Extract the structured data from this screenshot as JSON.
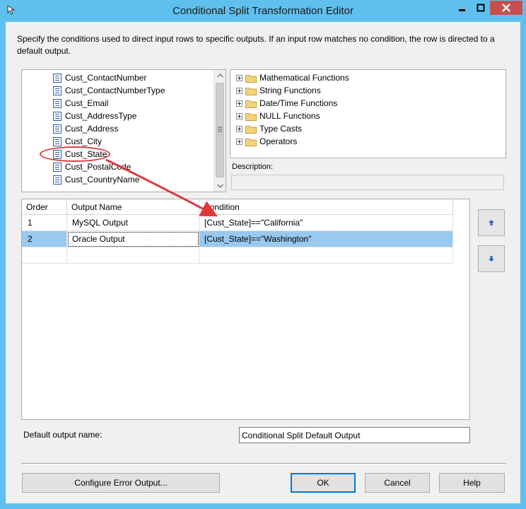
{
  "window": {
    "title": "Conditional Split Transformation Editor"
  },
  "instructions": "Specify the conditions used to direct input rows to specific outputs. If an input row matches no condition, the row is directed to a default output.",
  "columns": [
    "Cust_ContactNumber",
    "Cust_ContactNumberType",
    "Cust_Email",
    "Cust_AddressType",
    "Cust_Address",
    "Cust_City",
    "Cust_State",
    "Cust_PostalCode",
    "Cust_CountryName"
  ],
  "functions": [
    "Mathematical Functions",
    "String Functions",
    "Date/Time Functions",
    "NULL Functions",
    "Type Casts",
    "Operators"
  ],
  "description": {
    "label": "Description:",
    "value": ""
  },
  "grid": {
    "headers": [
      "Order",
      "Output Name",
      "Condition"
    ],
    "rows": [
      {
        "order": "1",
        "name": "MySQL Output",
        "condition": "[Cust_State]==\"California\""
      },
      {
        "order": "2",
        "name": "Oracle Output",
        "condition": "[Cust_State]==\"Washington\""
      }
    ],
    "selected_row": 2
  },
  "default_output": {
    "label": "Default output name:",
    "value": "Conditional Split Default Output"
  },
  "buttons": {
    "configure_error": "Configure Error Output...",
    "ok": "OK",
    "cancel": "Cancel",
    "help": "Help"
  },
  "annotation": {
    "highlighted_column": "Cust_State",
    "color": "#e0383a"
  },
  "colors": {
    "titlebar": "#5fc0ee",
    "selection": "#99c9ef",
    "close_button": "#c7504e"
  }
}
